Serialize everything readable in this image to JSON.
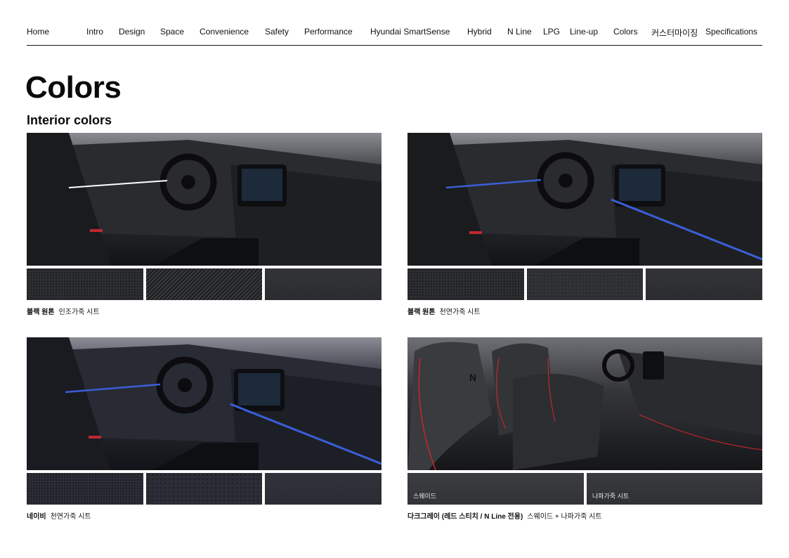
{
  "nav": {
    "items": [
      "Home",
      "Intro",
      "Design",
      "Space",
      "Convenience",
      "Safety",
      "Performance",
      "Hyundai SmartSense",
      "Hybrid",
      "N Line",
      "LPG",
      "Line-up",
      "Colors",
      "커스터마이징",
      "Specifications"
    ]
  },
  "page_title": "Colors",
  "section_title": "Interior colors",
  "cards": [
    {
      "name": "블랙 원톤",
      "desc": "인조가죽 시트",
      "accent": "#ffffff",
      "swatch_labels": []
    },
    {
      "name": "블랙 원톤",
      "desc": "천연가죽 시트",
      "accent": "#3a5fd9",
      "swatch_labels": []
    },
    {
      "name": "네이비",
      "desc": "천연가죽 시트",
      "accent": "#3a5fd9",
      "swatch_labels": []
    },
    {
      "name": "다크그레이 (레드 스티치 / N Line 전용)",
      "desc": "스웨이드 + 나파가죽 시트",
      "accent": "#c0272d",
      "swatch_labels": [
        "스웨이드",
        "나파가죽 시트"
      ]
    }
  ]
}
